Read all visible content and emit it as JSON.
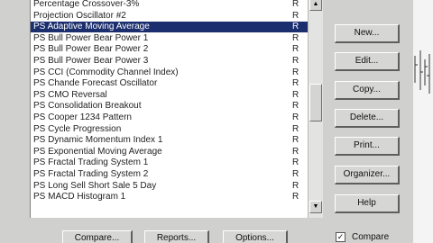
{
  "indicator_list": {
    "items": [
      {
        "name": "Percentage Crossover-3%",
        "flag": "R"
      },
      {
        "name": "Projection Oscillator #2",
        "flag": "R"
      },
      {
        "name": "PS Adaptive Moving Average",
        "flag": "R",
        "selected": true
      },
      {
        "name": "PS Bull Power Bear Power 1",
        "flag": "R"
      },
      {
        "name": "PS Bull Power Bear Power 2",
        "flag": "R"
      },
      {
        "name": "PS Bull Power Bear Power 3",
        "flag": "R"
      },
      {
        "name": "PS CCI (Commodity Channel Index)",
        "flag": "R"
      },
      {
        "name": "PS Chande Forecast Oscillator",
        "flag": "R"
      },
      {
        "name": "PS CMO Reversal",
        "flag": "R"
      },
      {
        "name": "PS Consolidation Breakout",
        "flag": "R"
      },
      {
        "name": "PS Cooper 1234 Pattern",
        "flag": "R"
      },
      {
        "name": "PS Cycle Progression",
        "flag": "R"
      },
      {
        "name": "PS Dynamic Momentum Index 1",
        "flag": "R"
      },
      {
        "name": "PS Exponential Moving Average",
        "flag": "R"
      },
      {
        "name": "PS Fractal Trading System 1",
        "flag": "R"
      },
      {
        "name": "PS Fractal Trading System 2",
        "flag": "R"
      },
      {
        "name": "PS Long Sell Short Sale 5 Day",
        "flag": "R"
      },
      {
        "name": "PS MACD Histogram 1",
        "flag": "R"
      }
    ]
  },
  "buttons": {
    "new": "New...",
    "edit": "Edit...",
    "copy": "Copy...",
    "delete": "Delete...",
    "print": "Print...",
    "organizer": "Organizer...",
    "help": "Help"
  },
  "bottom_buttons": {
    "compare": "Compare...",
    "reports": "Reports...",
    "options": "Options..."
  },
  "compare_checkbox": {
    "label": "Compare",
    "checked": true,
    "mark": "✓"
  },
  "scrollbar": {
    "up_arrow": "▲",
    "down_arrow": "▼"
  },
  "colors": {
    "dialog_bg": "#d0d0cf",
    "selection_bg": "#1b2e6e",
    "list_bg": "#ffffff"
  }
}
